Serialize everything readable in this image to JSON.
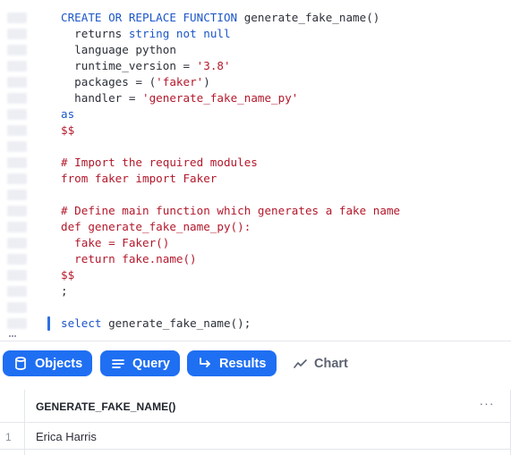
{
  "editor": {
    "lines": [
      [
        {
          "t": "CREATE OR REPLACE FUNCTION",
          "c": "kw"
        },
        {
          "t": " generate_fake_name()",
          "c": ""
        }
      ],
      [
        {
          "t": "  returns ",
          "c": ""
        },
        {
          "t": "string not null",
          "c": "kw"
        }
      ],
      [
        {
          "t": "  language python",
          "c": ""
        }
      ],
      [
        {
          "t": "  runtime_version = ",
          "c": ""
        },
        {
          "t": "'3.8'",
          "c": "str"
        }
      ],
      [
        {
          "t": "  packages = (",
          "c": ""
        },
        {
          "t": "'faker'",
          "c": "str"
        },
        {
          "t": ")",
          "c": ""
        }
      ],
      [
        {
          "t": "  handler = ",
          "c": ""
        },
        {
          "t": "'generate_fake_name_py'",
          "c": "str"
        }
      ],
      [
        {
          "t": "as",
          "c": "kw"
        }
      ],
      [
        {
          "t": "$$",
          "c": "dol"
        }
      ],
      [
        {
          "t": "",
          "c": ""
        }
      ],
      [
        {
          "t": "# Import the required modules",
          "c": "cmt"
        }
      ],
      [
        {
          "t": "from faker import Faker",
          "c": "cmt"
        }
      ],
      [
        {
          "t": "",
          "c": ""
        }
      ],
      [
        {
          "t": "# Define main function which generates a fake name",
          "c": "cmt"
        }
      ],
      [
        {
          "t": "def generate_fake_name_py():",
          "c": "cmt"
        }
      ],
      [
        {
          "t": "  fake = Faker()",
          "c": "cmt"
        }
      ],
      [
        {
          "t": "  return fake.name()",
          "c": "cmt"
        }
      ],
      [
        {
          "t": "$$",
          "c": "dol"
        }
      ],
      [
        {
          "t": ";",
          "c": ""
        }
      ],
      [
        {
          "t": "",
          "c": ""
        }
      ],
      [
        {
          "t": "select",
          "c": "kw"
        },
        {
          "t": " generate_fake_name();",
          "c": ""
        }
      ]
    ]
  },
  "tabs": {
    "objects": {
      "label": "Objects",
      "icon": "database-icon",
      "active": true
    },
    "query": {
      "label": "Query",
      "icon": "list-icon",
      "active": true
    },
    "results": {
      "label": "Results",
      "icon": "return-arrow-icon",
      "active": true
    },
    "chart": {
      "label": "Chart",
      "icon": "line-chart-icon",
      "active": false
    }
  },
  "results": {
    "columns": [
      "GENERATE_FAKE_NAME()"
    ],
    "menu_label": "···",
    "rows": [
      {
        "num": "1",
        "values": [
          "Erica Harris"
        ]
      }
    ]
  },
  "colors": {
    "accent": "#1f6ff2",
    "keyword": "#1c56c8",
    "string": "#b3182b"
  }
}
